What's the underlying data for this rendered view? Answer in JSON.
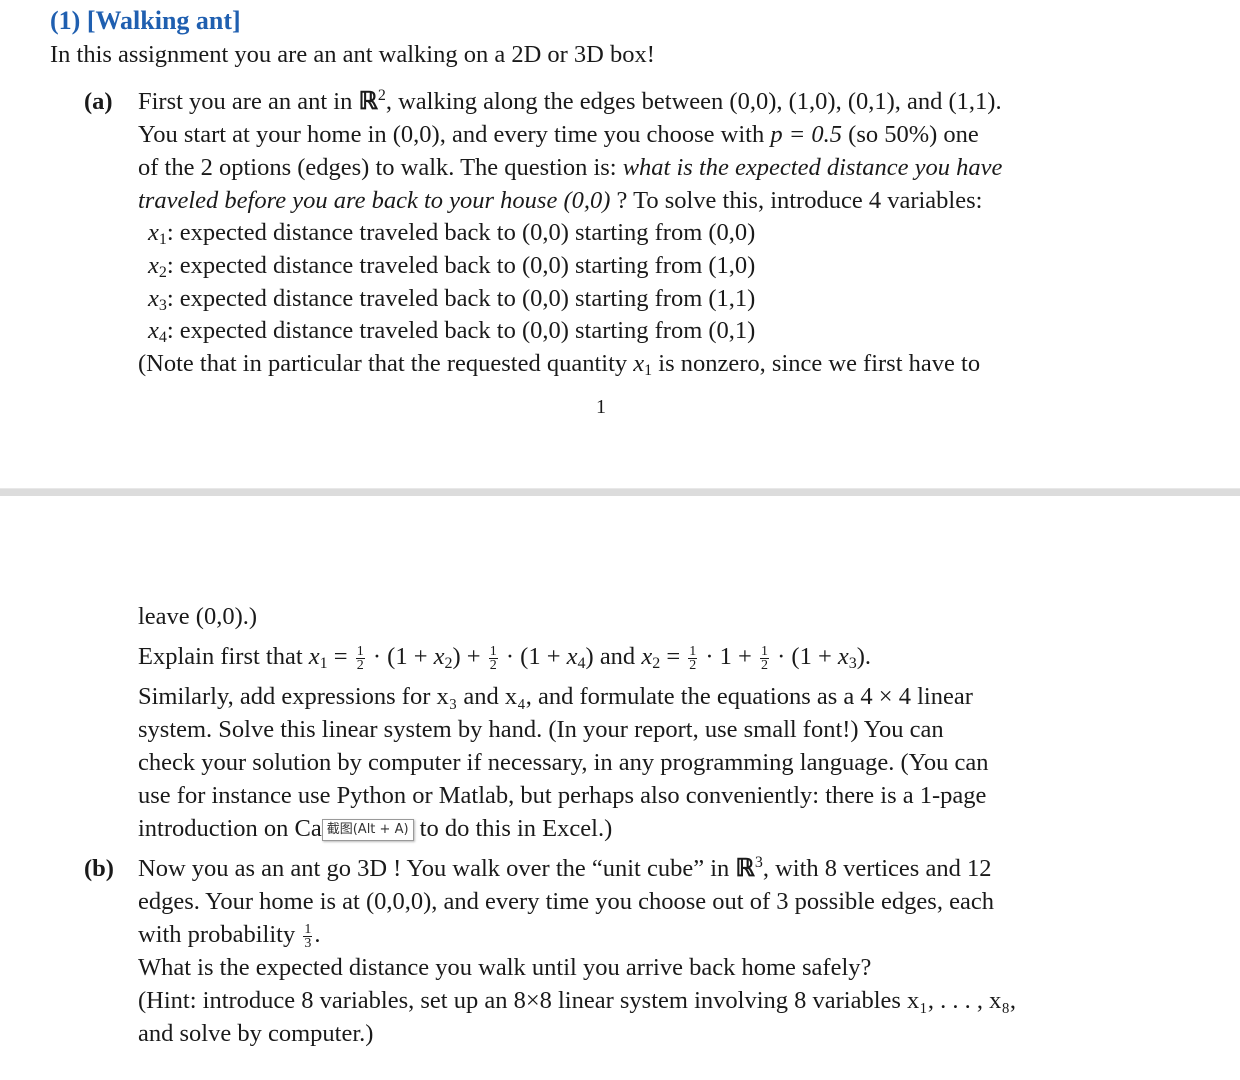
{
  "page1": {
    "title": "(1) [Walking ant]",
    "intro": "In this assignment you are an ant walking on a 2D or 3D box!",
    "part_a_label": "(a)",
    "a_line1_pre": "First you are an ant in ",
    "a_line1_R": "ℝ",
    "a_line1_sup": "2",
    "a_line1_post": ", walking along the edges between (0,0), (1,0), (0,1), and (1,1).",
    "a_line2": "You start at your home in (0,0), and every time you choose with ",
    "a_line2_math": "p = 0.5",
    "a_line2_post": " (so 50%) one",
    "a_line3_pre": "of the 2 options (edges) to walk. The question is: ",
    "a_line3_italic": "what is the expected distance you have",
    "a_line4_italic": "traveled before you are back to your house (0,0)",
    "a_line4_post": " ? To solve this, introduce 4 variables:",
    "variables": [
      {
        "sym": "x",
        "sub": "1",
        "text": ": expected distance traveled back to (0,0) starting from (0,0)"
      },
      {
        "sym": "x",
        "sub": "2",
        "text": ": expected distance traveled back to (0,0) starting from (1,0)"
      },
      {
        "sym": "x",
        "sub": "3",
        "text": ": expected distance traveled back to (0,0) starting from (1,1)"
      },
      {
        "sym": "x",
        "sub": "4",
        "text": ": expected distance traveled back to (0,0) starting from (0,1)"
      }
    ],
    "note_pre": "(Note that in particular that the requested quantity ",
    "note_post": " is nonzero, since we first have to",
    "page_number": "1"
  },
  "page2": {
    "leave": "leave (0,0).)",
    "explain_pre": "Explain first that ",
    "explain_mid": " and ",
    "similarly": "Similarly, add expressions for x₃ and x₄, and formulate the equations as a 4 × 4 linear",
    "system": "system.  Solve this linear system by hand.  (In your report, use small font!)  You can",
    "check": "check your solution by computer if necessary, in any programming language.  (You can",
    "use": "use for instance use Python or Matlab, but perhaps also conveniently: there is a 1-page",
    "intro_pre": "introduction on Ca",
    "intro_post": " to do this in Excel.)",
    "tooltip": "截图(Alt + A)",
    "part_b_label": "(b)",
    "b_line1_pre": "Now you as an ant go 3D ! You walk over the “unit cube” in ",
    "b_line1_sup": "3",
    "b_line1_post": ", with 8 vertices and 12",
    "b_line2": "edges.  Your home is at (0,0,0), and every time you choose out of 3 possible edges, each",
    "b_line3": "with probability ",
    "b_line4": "What is the expected distance you walk until you arrive back home safely?",
    "b_line5": "(Hint: introduce 8 variables, set up an 8×8 linear system involving 8 variables x₁, . . . , x₈,",
    "b_line6": "and solve by computer.)"
  }
}
